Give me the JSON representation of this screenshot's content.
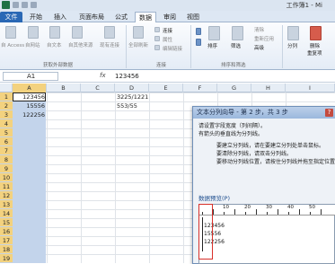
{
  "window": {
    "title": "工作簿1 - Mi"
  },
  "tabs": [
    {
      "label": "文件"
    },
    {
      "label": "开始"
    },
    {
      "label": "插入"
    },
    {
      "label": "页面布局"
    },
    {
      "label": "公式"
    },
    {
      "label": "数据"
    },
    {
      "label": "审阅"
    },
    {
      "label": "视图"
    }
  ],
  "ribbon": {
    "get_external": {
      "buttons": [
        "自 Access",
        "自网站",
        "自文本",
        "自其他来源",
        "现有连接"
      ],
      "label": "获取外部数据"
    },
    "connections": {
      "refresh": "全部刷新",
      "connect": "连接",
      "props": "属性",
      "edit_links": "编辑链接",
      "label": "连接"
    },
    "sort_filter": {
      "sort": "排序",
      "filter": "筛选",
      "clear": "清除",
      "reapply": "重新应用",
      "advanced": "高级",
      "label": "排序和筛选"
    },
    "tools": {
      "split": "分列",
      "remove_dup": "删除",
      "remove_dup2": "重复项"
    }
  },
  "formula_bar": {
    "name": "A1",
    "fx": "fx",
    "value": "123456"
  },
  "columns": [
    "A",
    "B",
    "C",
    "D",
    "E",
    "F",
    "G",
    "H",
    "I"
  ],
  "rows": [
    "1",
    "2",
    "3",
    "4",
    "5",
    "6",
    "7",
    "8",
    "9",
    "10",
    "11",
    "12",
    "13",
    "14",
    "15",
    "16",
    "17",
    "18",
    "19"
  ],
  "cells": {
    "a1": "123456",
    "a2": "15556",
    "a3": "122256",
    "d1": "3225/1221",
    "d2": "553/55"
  },
  "dialog": {
    "title": "文本分列向导 - 第 2 步，共 3 步",
    "close": "?",
    "line1": "请设置字段宽度（列间隔）。",
    "line2": "有箭头的垂直线为分列线。",
    "line3": "要建立分列线，请在要建立分列处单击鼠标。",
    "line4": "要清除分列线，请双击分列线。",
    "line5": "要移动分列线位置，请按住分列线并拖至指定位置。",
    "preview_label": "数据预览(P)",
    "ruler": [
      "10",
      "20",
      "30",
      "40",
      "50"
    ],
    "preview_lines": [
      "123456",
      "15556",
      "122256"
    ]
  }
}
